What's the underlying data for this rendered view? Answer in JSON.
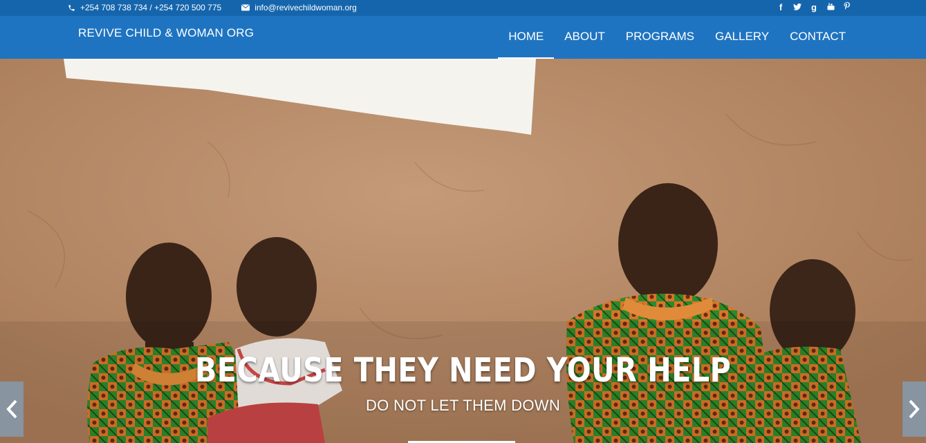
{
  "topbar": {
    "phone": "+254 708 738 734 / +254 720 500 775",
    "email": "info@revivechildwoman.org",
    "phone_icon": "phone-icon",
    "email_icon": "envelope-icon",
    "social": [
      {
        "name": "facebook-icon",
        "glyph": "f"
      },
      {
        "name": "twitter-icon",
        "glyph": "t"
      },
      {
        "name": "google-plus-icon",
        "glyph": "g"
      },
      {
        "name": "youtube-icon",
        "glyph": "▶"
      },
      {
        "name": "pinterest-icon",
        "glyph": "p"
      }
    ]
  },
  "nav": {
    "brand": "REVIVE CHILD & WOMAN ORG",
    "items": [
      {
        "label": "HOME",
        "active": true
      },
      {
        "label": "ABOUT",
        "active": false
      },
      {
        "label": "PROGRAMS",
        "active": false
      },
      {
        "label": "GALLERY",
        "active": false
      },
      {
        "label": "CONTACT",
        "active": false
      }
    ]
  },
  "hero": {
    "headline": "BECAUSE THEY NEED YOUR HELP",
    "subline": "DO NOT LET THEM DOWN",
    "prev_icon": "chevron-left-icon",
    "next_icon": "chevron-right-icon"
  },
  "colors": {
    "topbar": "#1565ad",
    "navbar": "#1f74c1",
    "text": "#ffffff",
    "wall": "#b08461"
  }
}
